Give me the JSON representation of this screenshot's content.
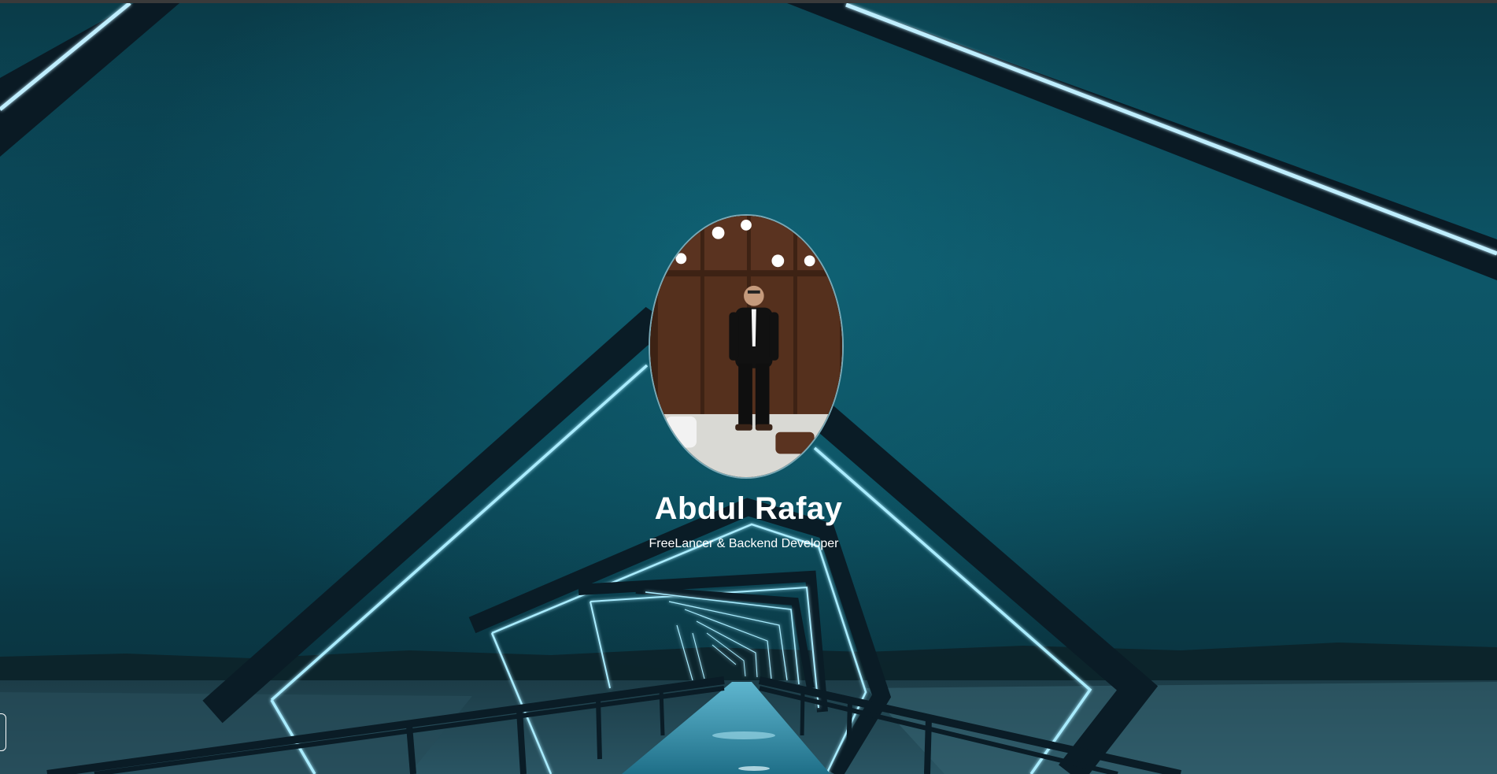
{
  "profile": {
    "name": "Abdul Rafay",
    "subtitle": "FreeLancer & Backend Developer"
  },
  "background": {
    "description_icon": "neon-bridge-background",
    "colors": {
      "sky": "#0d5668",
      "neon": "#8fe3ff",
      "frame": "#0a1c26"
    }
  },
  "side_tab": {
    "icon": "side-panel-toggle-icon"
  }
}
